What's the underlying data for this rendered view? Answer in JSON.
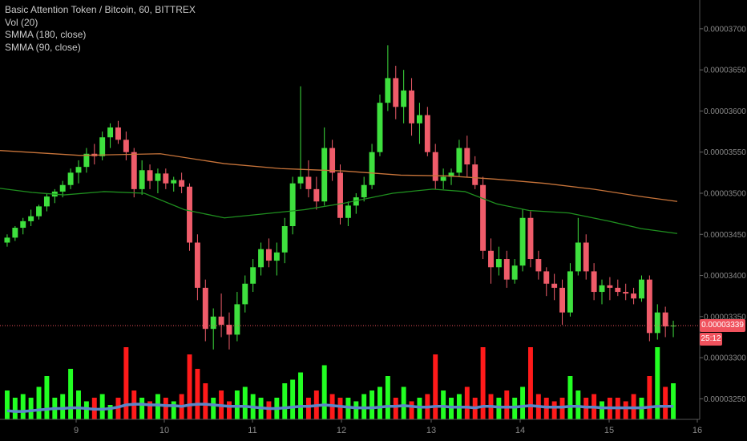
{
  "header": {
    "title": "Basic Attention Token / Bitcoin, 60, BITTREX",
    "indicators": [
      "Vol (20)",
      "SMMA (180, close)",
      "SMMA (90, close)"
    ]
  },
  "price_tag": {
    "value": "0.00003339",
    "countdown": "25:12",
    "color": "#f0525d"
  },
  "colors": {
    "up": "#3ee03e",
    "down": "#ef5c6a",
    "vol_up": "#22ff22",
    "vol_down": "#ff1a1a",
    "smma180": "#c8743a",
    "smma90": "#1f8f1f",
    "vol_ma": "#5b86c8",
    "axis": "#888888"
  },
  "chart_data": {
    "type": "candlestick",
    "y_axis": {
      "ticks": [
        "0.00003700",
        "0.00003650",
        "0.00003600",
        "0.00003550",
        "0.00003500",
        "0.00003450",
        "0.00003400",
        "0.00003350",
        "0.00003300",
        "0.00003250"
      ],
      "range": [
        3.225e-05,
        3.735e-05
      ]
    },
    "x_axis": {
      "ticks": [
        "9",
        "10",
        "11",
        "12",
        "13",
        "14",
        "15",
        "16"
      ],
      "tick_x": [
        95,
        205,
        315,
        426,
        538,
        649,
        760,
        870
      ]
    },
    "candles": [
      [
        3440,
        3450,
        3435,
        3446
      ],
      [
        3446,
        3460,
        3442,
        3458
      ],
      [
        3458,
        3470,
        3450,
        3466
      ],
      [
        3466,
        3480,
        3460,
        3472
      ],
      [
        3472,
        3486,
        3468,
        3484
      ],
      [
        3484,
        3500,
        3478,
        3496
      ],
      [
        3496,
        3505,
        3488,
        3502
      ],
      [
        3502,
        3515,
        3495,
        3510
      ],
      [
        3510,
        3530,
        3505,
        3525
      ],
      [
        3525,
        3540,
        3512,
        3532
      ],
      [
        3532,
        3555,
        3525,
        3548
      ],
      [
        3548,
        3560,
        3535,
        3545
      ],
      [
        3545,
        3575,
        3540,
        3568
      ],
      [
        3568,
        3585,
        3555,
        3580
      ],
      [
        3580,
        3588,
        3560,
        3565
      ],
      [
        3565,
        3575,
        3540,
        3550
      ],
      [
        3550,
        3555,
        3495,
        3505
      ],
      [
        3505,
        3540,
        3498,
        3528
      ],
      [
        3528,
        3535,
        3505,
        3515
      ],
      [
        3515,
        3530,
        3500,
        3524
      ],
      [
        3524,
        3530,
        3505,
        3512
      ],
      [
        3512,
        3520,
        3502,
        3516
      ],
      [
        3516,
        3525,
        3500,
        3508
      ],
      [
        3508,
        3512,
        3430,
        3440
      ],
      [
        3440,
        3450,
        3370,
        3385
      ],
      [
        3385,
        3395,
        3320,
        3335
      ],
      [
        3335,
        3360,
        3310,
        3350
      ],
      [
        3350,
        3378,
        3325,
        3340
      ],
      [
        3340,
        3355,
        3310,
        3328
      ],
      [
        3328,
        3380,
        3320,
        3365
      ],
      [
        3365,
        3400,
        3355,
        3390
      ],
      [
        3390,
        3420,
        3380,
        3410
      ],
      [
        3410,
        3440,
        3400,
        3432
      ],
      [
        3432,
        3445,
        3410,
        3418
      ],
      [
        3418,
        3440,
        3400,
        3428
      ],
      [
        3428,
        3470,
        3415,
        3460
      ],
      [
        3460,
        3520,
        3450,
        3512
      ],
      [
        3512,
        3630,
        3505,
        3520
      ],
      [
        3520,
        3540,
        3495,
        3505
      ],
      [
        3505,
        3520,
        3480,
        3490
      ],
      [
        3490,
        3580,
        3485,
        3555
      ],
      [
        3555,
        3565,
        3515,
        3525
      ],
      [
        3525,
        3535,
        3462,
        3470
      ],
      [
        3470,
        3490,
        3460,
        3485
      ],
      [
        3485,
        3500,
        3475,
        3495
      ],
      [
        3495,
        3520,
        3490,
        3510
      ],
      [
        3510,
        3560,
        3505,
        3550
      ],
      [
        3550,
        3620,
        3545,
        3610
      ],
      [
        3610,
        3680,
        3600,
        3640
      ],
      [
        3640,
        3655,
        3590,
        3605
      ],
      [
        3605,
        3650,
        3585,
        3625
      ],
      [
        3625,
        3640,
        3570,
        3585
      ],
      [
        3585,
        3610,
        3560,
        3595
      ],
      [
        3595,
        3605,
        3545,
        3550
      ],
      [
        3550,
        3560,
        3505,
        3515
      ],
      [
        3515,
        3530,
        3505,
        3520
      ],
      [
        3520,
        3530,
        3510,
        3525
      ],
      [
        3525,
        3565,
        3520,
        3555
      ],
      [
        3555,
        3570,
        3520,
        3535
      ],
      [
        3535,
        3545,
        3505,
        3510
      ],
      [
        3510,
        3520,
        3420,
        3430
      ],
      [
        3430,
        3445,
        3390,
        3410
      ],
      [
        3410,
        3435,
        3400,
        3420
      ],
      [
        3420,
        3430,
        3385,
        3395
      ],
      [
        3395,
        3420,
        3390,
        3412
      ],
      [
        3412,
        3480,
        3405,
        3470
      ],
      [
        3470,
        3478,
        3410,
        3420
      ],
      [
        3420,
        3430,
        3395,
        3405
      ],
      [
        3405,
        3410,
        3375,
        3390
      ],
      [
        3390,
        3402,
        3370,
        3385
      ],
      [
        3385,
        3395,
        3340,
        3355
      ],
      [
        3355,
        3415,
        3350,
        3405
      ],
      [
        3405,
        3470,
        3400,
        3440
      ],
      [
        3440,
        3450,
        3395,
        3405
      ],
      [
        3405,
        3415,
        3370,
        3380
      ],
      [
        3380,
        3395,
        3365,
        3388
      ],
      [
        3388,
        3398,
        3370,
        3385
      ],
      [
        3385,
        3395,
        3375,
        3380
      ],
      [
        3380,
        3390,
        3370,
        3378
      ],
      [
        3378,
        3385,
        3365,
        3372
      ],
      [
        3372,
        3400,
        3368,
        3395
      ],
      [
        3395,
        3400,
        3320,
        3330
      ],
      [
        3330,
        3365,
        3322,
        3355
      ],
      [
        3355,
        3362,
        3325,
        3338
      ],
      [
        3338,
        3345,
        3325,
        3339
      ]
    ],
    "volume_scale_max": 100,
    "volumes": [
      40,
      30,
      35,
      30,
      45,
      60,
      30,
      35,
      70,
      40,
      25,
      30,
      35,
      20,
      30,
      100,
      40,
      30,
      25,
      35,
      30,
      25,
      35,
      90,
      70,
      50,
      30,
      40,
      25,
      40,
      45,
      35,
      30,
      25,
      30,
      50,
      55,
      65,
      30,
      40,
      75,
      35,
      30,
      30,
      25,
      35,
      40,
      45,
      60,
      30,
      45,
      25,
      30,
      35,
      90,
      40,
      30,
      35,
      45,
      30,
      100,
      35,
      30,
      40,
      30,
      45,
      100,
      35,
      30,
      25,
      30,
      60,
      40,
      30,
      35,
      25,
      30,
      30,
      25,
      35,
      30,
      60,
      100,
      45,
      50
    ],
    "volume_ma": [
      12,
      11,
      11,
      12,
      13,
      14,
      15,
      15,
      16,
      16,
      15,
      14,
      14,
      15,
      17,
      20,
      21,
      21,
      20,
      20,
      19,
      19,
      18,
      20,
      21,
      21,
      20,
      19,
      18,
      18,
      18,
      17,
      16,
      15,
      15,
      16,
      17,
      18,
      18,
      19,
      20,
      19,
      18,
      17,
      16,
      16,
      16,
      17,
      18,
      18,
      19,
      18,
      17,
      17,
      18,
      18,
      17,
      17,
      17,
      16,
      18,
      18,
      17,
      17,
      17,
      18,
      19,
      18,
      17,
      17,
      17,
      18,
      18,
      17,
      17,
      16,
      16,
      16,
      16,
      16,
      16,
      17,
      18,
      18,
      18
    ],
    "smma180": [
      [
        0,
        3552
      ],
      [
        100,
        3546
      ],
      [
        200,
        3548
      ],
      [
        280,
        3536
      ],
      [
        350,
        3530
      ],
      [
        430,
        3527
      ],
      [
        500,
        3522
      ],
      [
        560,
        3521
      ],
      [
        620,
        3517
      ],
      [
        680,
        3512
      ],
      [
        740,
        3505
      ],
      [
        800,
        3496
      ],
      [
        845,
        3490
      ]
    ],
    "smma90": [
      [
        0,
        3506
      ],
      [
        40,
        3501
      ],
      [
        80,
        3498
      ],
      [
        130,
        3502
      ],
      [
        180,
        3500
      ],
      [
        230,
        3480
      ],
      [
        280,
        3470
      ],
      [
        330,
        3475
      ],
      [
        380,
        3480
      ],
      [
        430,
        3488
      ],
      [
        490,
        3500
      ],
      [
        540,
        3505
      ],
      [
        580,
        3502
      ],
      [
        620,
        3487
      ],
      [
        660,
        3479
      ],
      [
        710,
        3476
      ],
      [
        760,
        3466
      ],
      [
        800,
        3457
      ],
      [
        845,
        3451
      ]
    ]
  }
}
